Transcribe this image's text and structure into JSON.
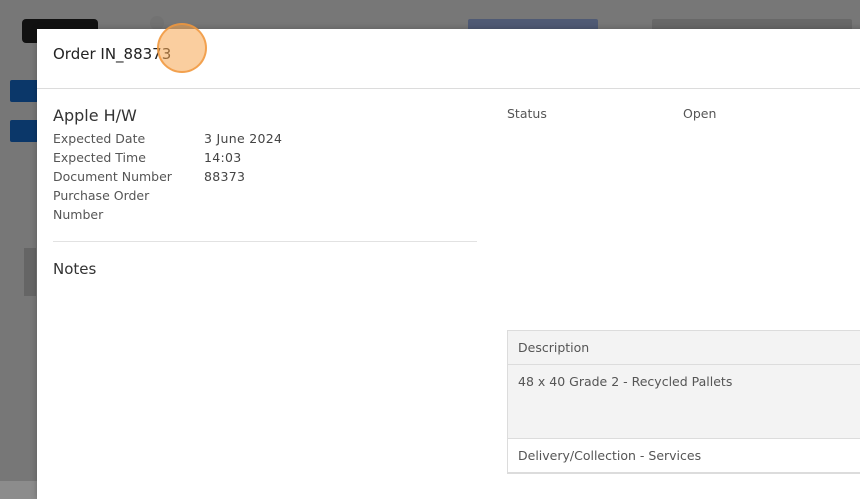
{
  "modal": {
    "title": "Order IN_88373",
    "supplier": "Apple H/W",
    "details": [
      {
        "label": "Expected Date",
        "value": "3 June 2024"
      },
      {
        "label": "Expected Time",
        "value": "14:03"
      },
      {
        "label": "Document Number",
        "value": "88373"
      },
      {
        "label": "Purchase Order Number",
        "value": ""
      }
    ],
    "notes_title": "Notes",
    "status": {
      "label": "Status",
      "value": "Open"
    },
    "table": {
      "header": "Description",
      "item": "48 x 40 Grade 2 - Recycled Pallets",
      "section": "Delivery/Collection - Services"
    }
  }
}
